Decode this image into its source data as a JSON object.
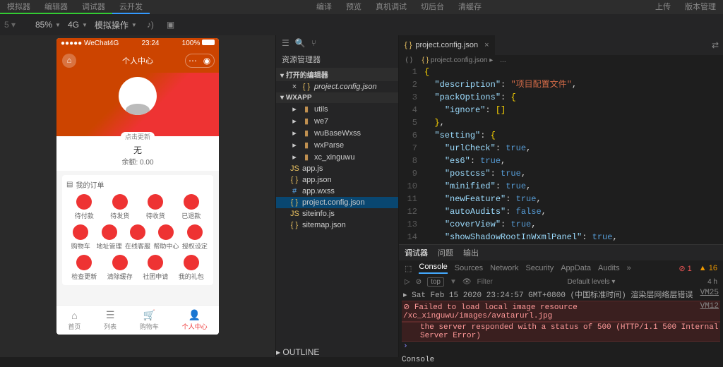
{
  "toolbar1": {
    "simulator": "模拟器",
    "editor": "编辑器",
    "debugger": "调试器",
    "clouddev": "云开发",
    "compile": "编译",
    "preview": "预览",
    "realdevice": "真机调试",
    "background": "切后台",
    "clearcache": "清缓存",
    "upload": "上传",
    "version": "版本管理"
  },
  "toolbar2": {
    "zoom": "85%",
    "network": "4G",
    "simop": "模拟操作"
  },
  "phone": {
    "carrier": "●●●●● WeChat4G",
    "time": "23:24",
    "battery": "100%",
    "title": "个人中心",
    "tap_hint": "点击更新",
    "username": "无",
    "balance": "余额: 0.00",
    "orders_title": "我的订单",
    "row1": [
      "待付款",
      "待发货",
      "待收货",
      "已退款"
    ],
    "row2": [
      "购物车",
      "地址管理",
      "在线客服",
      "帮助中心",
      "授权设定"
    ],
    "row3": [
      "检查更新",
      "清除缓存",
      "社团申请",
      "我的礼包"
    ],
    "tabs": [
      "首页",
      "列表",
      "购物车",
      "个人中心"
    ]
  },
  "explorer": {
    "title": "资源管理器",
    "open_editors": "打开的编辑器",
    "file_open": "project.config.json",
    "root": "WXAPP",
    "folders": [
      "utils",
      "we7",
      "wuBaseWxss",
      "wxParse",
      "xc_xinguwu"
    ],
    "files": [
      "app.js",
      "app.json",
      "app.wxss",
      "project.config.json",
      "siteinfo.js",
      "sitemap.json"
    ],
    "outline": "OUTLINE"
  },
  "editor": {
    "tab": "project.config.json",
    "crumb_file": "project.config.json",
    "crumb_dots": "...",
    "lines": [
      {
        "n": 1,
        "indent": 0,
        "raw": "{"
      },
      {
        "n": 2,
        "indent": 1,
        "key": "description",
        "strz": "项目配置文件",
        "comma": true
      },
      {
        "n": 3,
        "indent": 1,
        "key": "packOptions",
        "open": true
      },
      {
        "n": 4,
        "indent": 2,
        "key": "ignore",
        "arr": true
      },
      {
        "n": 5,
        "indent": 1,
        "close": true,
        "comma": true
      },
      {
        "n": 6,
        "indent": 1,
        "key": "setting",
        "open": true
      },
      {
        "n": 7,
        "indent": 2,
        "key": "urlCheck",
        "bool": "true",
        "comma": true
      },
      {
        "n": 8,
        "indent": 2,
        "key": "es6",
        "bool": "true",
        "comma": true
      },
      {
        "n": 9,
        "indent": 2,
        "key": "postcss",
        "bool": "true",
        "comma": true
      },
      {
        "n": 10,
        "indent": 2,
        "key": "minified",
        "bool": "true",
        "comma": true
      },
      {
        "n": 11,
        "indent": 2,
        "key": "newFeature",
        "bool": "true",
        "comma": true
      },
      {
        "n": 12,
        "indent": 2,
        "key": "autoAudits",
        "bool": "false",
        "comma": true
      },
      {
        "n": 13,
        "indent": 2,
        "key": "coverView",
        "bool": "true",
        "comma": true
      },
      {
        "n": 14,
        "indent": 2,
        "key": "showShadowRootInWxmlPanel",
        "bool": "true",
        "comma": true
      }
    ]
  },
  "devtools": {
    "tabs1": [
      "调试器",
      "问题",
      "输出"
    ],
    "tabs2": [
      "Console",
      "Sources",
      "Network",
      "Security",
      "AppData",
      "Audits"
    ],
    "badge_err": "1",
    "badge_warn": "16",
    "filter_top": "top",
    "filter_ph": "Filter",
    "levels": "Default levels ▾",
    "hidden": "4 h",
    "log_ts": "▸ Sat Feb 15 2020 23:24:57 GMT+0800 (中国标准时间) 渲染层网络层错误",
    "log_src1": "VM25",
    "log_err": "Failed to load local image resource /xc_xinguwu/images/avatarurl.jpg",
    "log_sub": "the server responded with a status of 500 (HTTP/1.1 500 Internal Server Error)",
    "log_src2": "VM12",
    "prompt": "Console"
  }
}
